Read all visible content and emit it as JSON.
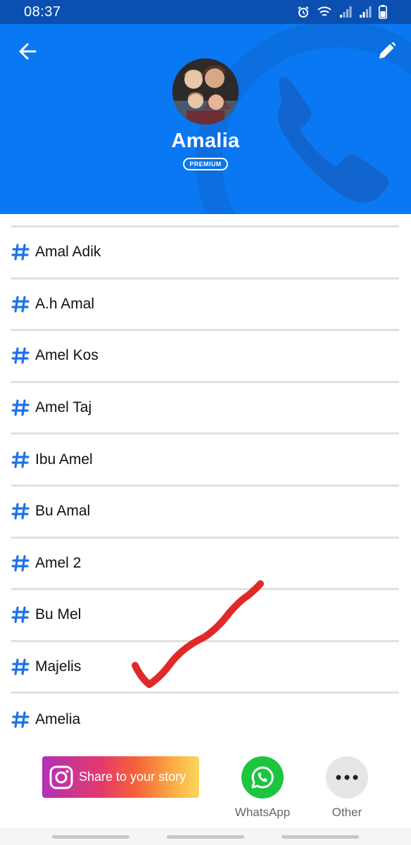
{
  "status_bar": {
    "time": "08:37",
    "icons": [
      "alarm-icon",
      "wifi-icon",
      "signal-icon",
      "signal-icon",
      "battery-icon"
    ]
  },
  "header": {
    "background_color": "#0a78f2",
    "back_icon": "arrow-left-icon",
    "edit_icon": "pencil-icon",
    "name": "Amalia",
    "badge": "PREMIUM"
  },
  "tags": [
    {
      "label": "Amal Adik"
    },
    {
      "label": "A.h Amal"
    },
    {
      "label": "Amel Kos"
    },
    {
      "label": "Amel Taj"
    },
    {
      "label": "Ibu Amel"
    },
    {
      "label": "Bu Amal"
    },
    {
      "label": "Amel 2"
    },
    {
      "label": "Bu Mel"
    },
    {
      "label": "Majelis"
    },
    {
      "label": "Amelia"
    }
  ],
  "share": {
    "story_label": "Share to your story",
    "whatsapp_label": "WhatsApp",
    "other_label": "Other"
  },
  "colors": {
    "accent": "#0a78f2",
    "hash": "#1a73e8",
    "whatsapp": "#1cc53e",
    "annotation": "#e02a2a"
  }
}
